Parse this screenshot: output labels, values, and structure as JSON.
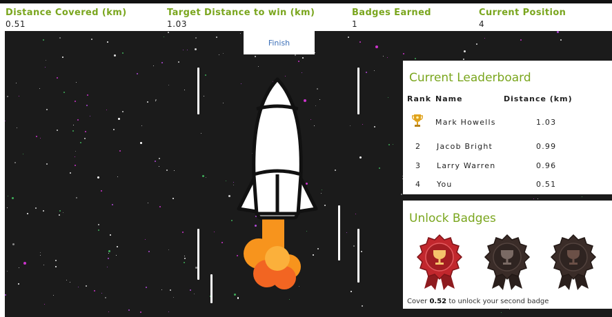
{
  "stats": [
    {
      "label": "Distance Covered (km)",
      "value": "0.51"
    },
    {
      "label": "Target Distance to win (km)",
      "value": "1.03"
    },
    {
      "label": "Badges Earned",
      "value": "1"
    },
    {
      "label": "Current Position",
      "value": "4"
    }
  ],
  "finish_label": "Finish",
  "leaderboard": {
    "title": "Current Leaderboard",
    "headers": {
      "rank": "Rank",
      "name": "Name",
      "distance": "Distance (km)"
    },
    "rows": [
      {
        "rank": "trophy-icon",
        "name": "Mark Howells",
        "distance": "1.03"
      },
      {
        "rank": "2",
        "name": "Jacob Bright",
        "distance": "0.99"
      },
      {
        "rank": "3",
        "name": "Larry Warren",
        "distance": "0.96"
      },
      {
        "rank": "4",
        "name": "You",
        "distance": "0.51"
      }
    ]
  },
  "badges": {
    "title": "Unlock Badges",
    "items": [
      {
        "name": "first-badge",
        "unlocked": true
      },
      {
        "name": "second-badge",
        "unlocked": false
      },
      {
        "name": "third-badge",
        "unlocked": false
      }
    ],
    "hint_prefix": "Cover ",
    "hint_amount": "0.52",
    "hint_suffix": " to unlock your second badge"
  },
  "colors": {
    "accent": "#7aa61e",
    "space": "#1b1b1b",
    "badge_unlocked": "#c1272d",
    "badge_locked": "#3a2c28",
    "flame": "#f7941d"
  }
}
